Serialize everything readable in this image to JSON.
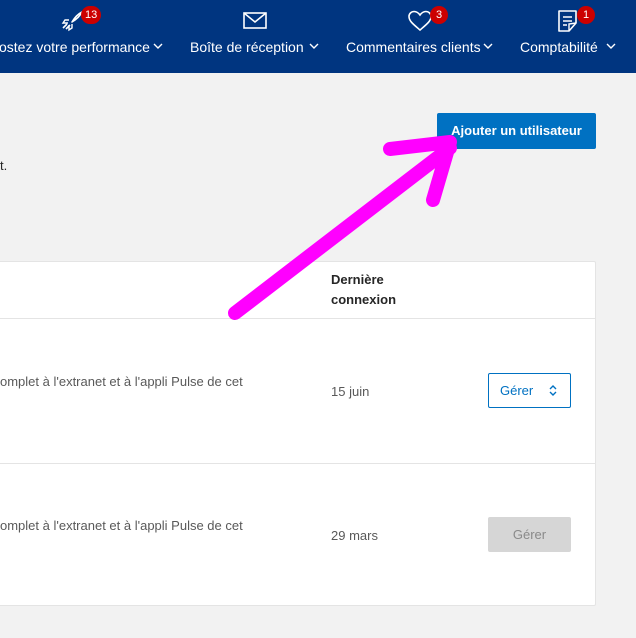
{
  "nav": {
    "items": [
      {
        "label": "ostez votre performance",
        "badge": "13",
        "icon": "rocket-icon"
      },
      {
        "label": "Boîte de réception",
        "badge": "",
        "icon": "envelope-icon"
      },
      {
        "label": "Commentaires clients",
        "badge": "3",
        "icon": "heart-icon"
      },
      {
        "label": "Comptabilité",
        "badge": "1",
        "icon": "invoice-icon"
      }
    ]
  },
  "header": {
    "add_user_label": "Ajouter un utilisateur",
    "description_fragment": "t."
  },
  "table": {
    "column_last_login": "Dernière\nconnexion",
    "rows": [
      {
        "description": "omplet à l'extranet et à l'appli Pulse de cet",
        "last_login": "15 juin",
        "manage_label": "Gérer",
        "enabled": true
      },
      {
        "description": "omplet à l'extranet et à l'appli Pulse de cet",
        "last_login": "29 mars",
        "manage_label": "Gérer",
        "enabled": false
      }
    ]
  },
  "colors": {
    "nav_bg": "#003580",
    "primary": "#0071c2",
    "badge": "#cc0000",
    "annotation_arrow": "#ff00ff"
  }
}
